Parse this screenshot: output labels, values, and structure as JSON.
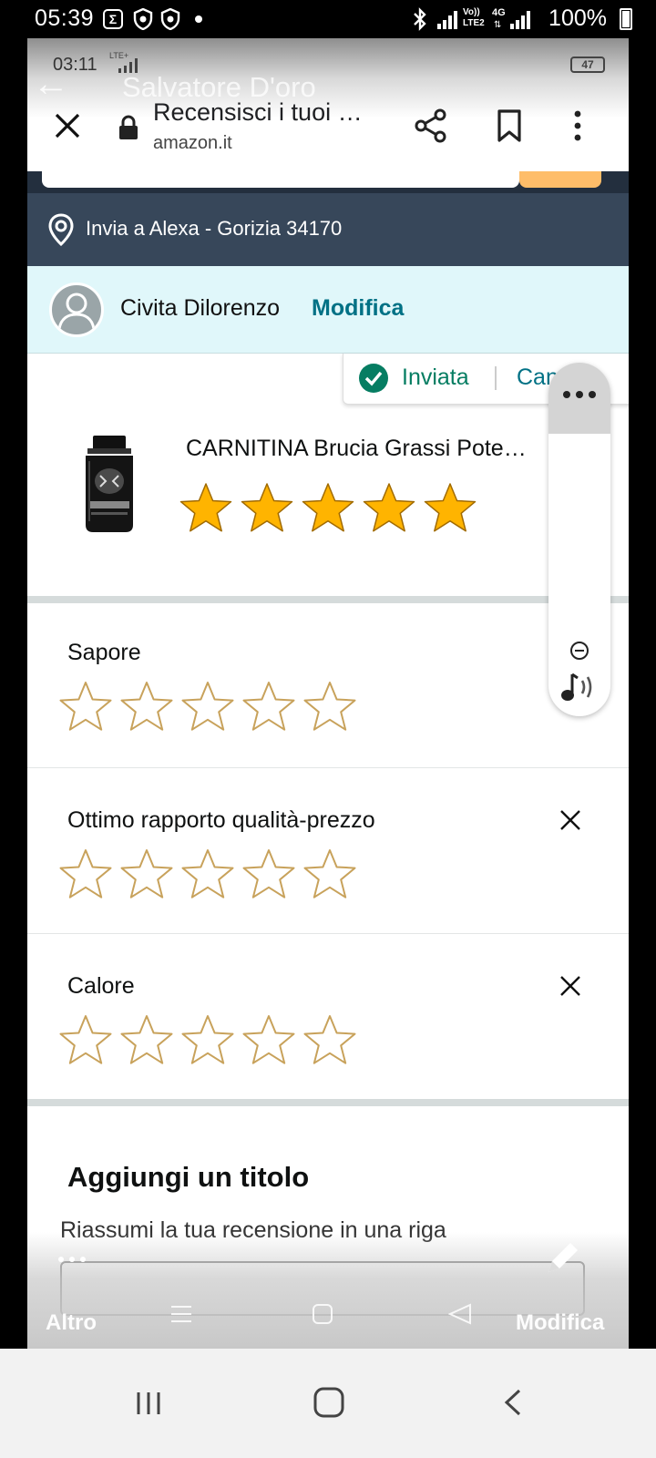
{
  "status_bar": {
    "time": "05:39",
    "right": "100%",
    "volte": "Vo))\nLTE2",
    "network": "4G"
  },
  "recorder_overlay": {
    "time": "03:11",
    "lte": "LTE+",
    "battery": "47",
    "ghost_title": "Salvatore D'oro"
  },
  "browser": {
    "page_title": "Recensisci i tuoi …",
    "domain": "amazon.it"
  },
  "location": {
    "text": "Invia a Alexa - Gorizia 34170"
  },
  "user": {
    "name": "Civita Dilorenzo",
    "edit_label": "Modifica"
  },
  "toast": {
    "status": "Inviata",
    "cancel": "Can"
  },
  "product": {
    "name": "CARNITINA Brucia Grassi Pote…",
    "rating": 5,
    "max_rating": 5
  },
  "attributes": [
    {
      "label": "Sapore",
      "rating": 0,
      "closable": false
    },
    {
      "label": "Ottimo rapporto qualità-prezzo",
      "rating": 0,
      "closable": true
    },
    {
      "label": "Calore",
      "rating": 0,
      "closable": true
    }
  ],
  "title_section": {
    "heading": "Aggiungi un titolo",
    "hint": "Riassumi la tua recensione in una riga"
  },
  "overlay_toolbar": {
    "left_label": "Altro",
    "right_label": "Modifica"
  },
  "colors": {
    "amazon_dark": "#232f3e",
    "location_bar": "#37475a",
    "user_bar": "#e0f7fa",
    "link": "#007185",
    "success": "#067d62",
    "star_fill": "#ffb400",
    "star_outline": "#c8a25b"
  }
}
